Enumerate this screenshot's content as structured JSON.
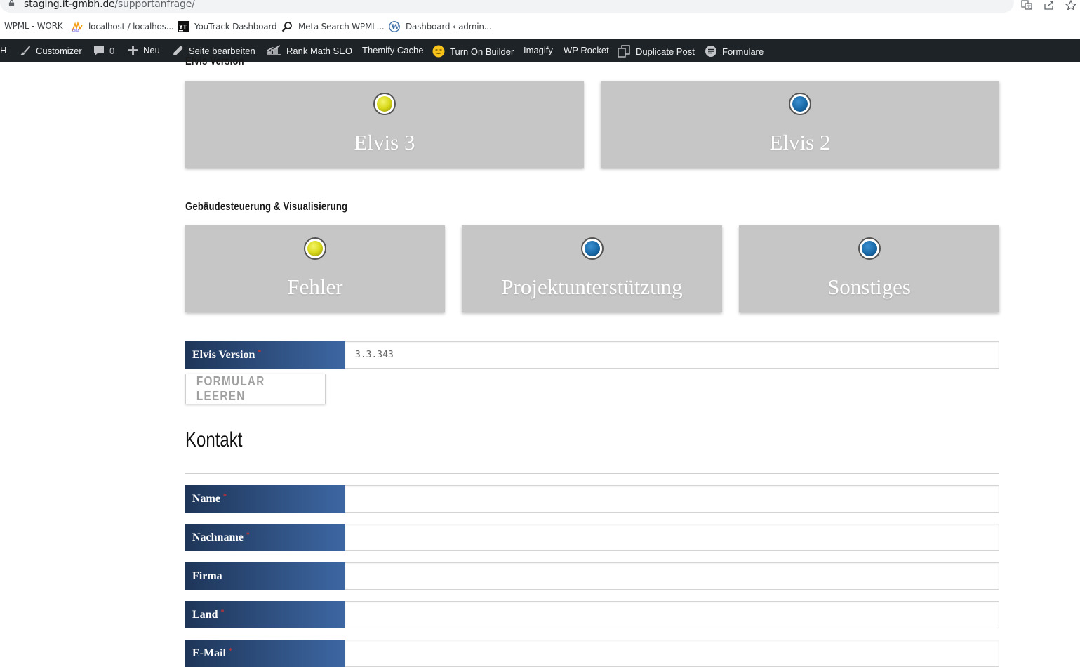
{
  "browser": {
    "url_host": "staging.it-gmbh.de",
    "url_path": "/supportanfrage/",
    "icons": [
      "lock-icon",
      "translate-icon",
      "share-icon",
      "star-icon"
    ]
  },
  "bookmarks": [
    {
      "label": "WPML - WORK",
      "icon": ""
    },
    {
      "label": "localhost / localhos...",
      "icon": "phpmyadmin-icon"
    },
    {
      "label": "YouTrack Dashboard",
      "icon": "youtrack-icon"
    },
    {
      "label": "Meta Search WPML...",
      "icon": "search-icon"
    },
    {
      "label": "Dashboard ‹ admin...",
      "icon": "wordpress-icon"
    }
  ],
  "adminbar": {
    "edge": "H",
    "customizer": "Customizer",
    "comments_count": "0",
    "new": "Neu",
    "edit_page": "Seite bearbeiten",
    "rank_math": "Rank Math SEO",
    "themify_cache": "Themify Cache",
    "builder": "Turn On Builder",
    "imagify": "Imagify",
    "wp_rocket": "WP Rocket",
    "duplicate": "Duplicate Post",
    "forms": "Formulare"
  },
  "form": {
    "elvis_section_title": "Elvis Version",
    "elvis_options": [
      {
        "label": "Elvis 3",
        "selected": true,
        "dot_color": "#d8d81a"
      },
      {
        "label": "Elvis 2",
        "selected": false,
        "dot_color": "#1a6aa8"
      }
    ],
    "building_section_title": "Gebäudesteuerung & Visualisierung",
    "building_options": [
      {
        "label": "Fehler",
        "selected": true,
        "dot_color": "#d8d81a"
      },
      {
        "label": "Projektunterstützung",
        "selected": false,
        "dot_color": "#1a6aa8"
      },
      {
        "label": "Sonstiges",
        "selected": false,
        "dot_color": "#1a6aa8"
      }
    ],
    "version_field": {
      "label": "Elvis Version",
      "required_mark": "*",
      "value": "3.3.343"
    },
    "clear_button": "FORMULAR LEEREN",
    "contact_title": "Kontakt",
    "contact_fields": [
      {
        "label": "Name",
        "required_mark": "*",
        "value": ""
      },
      {
        "label": "Nachname",
        "required_mark": "*",
        "value": ""
      },
      {
        "label": "Firma",
        "required_mark": "",
        "value": ""
      },
      {
        "label": "Land",
        "required_mark": "*",
        "value": ""
      },
      {
        "label": "E-Mail",
        "required_mark": "*",
        "value": ""
      }
    ],
    "label_gradient": [
      "#1e3558",
      "#3d67a3"
    ],
    "card_color": "#c6c6c6"
  }
}
